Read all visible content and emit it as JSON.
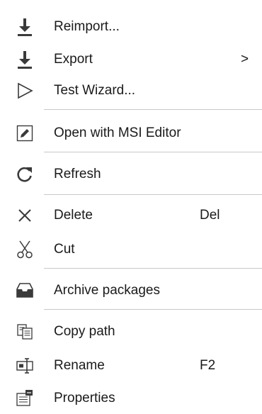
{
  "menu": {
    "items": [
      {
        "label": "Reimport...",
        "icon": "download-icon"
      },
      {
        "label": "Export",
        "icon": "download-icon",
        "submenu_indicator": ">"
      },
      {
        "label": "Test Wizard...",
        "icon": "play-outline-icon"
      },
      {
        "label": "Open with MSI Editor",
        "icon": "pencil-icon"
      },
      {
        "label": "Refresh",
        "icon": "refresh-icon"
      },
      {
        "label": "Delete",
        "icon": "close-icon",
        "shortcut": "Del"
      },
      {
        "label": "Cut",
        "icon": "scissors-icon"
      },
      {
        "label": "Archive packages",
        "icon": "archive-icon"
      },
      {
        "label": "Copy path",
        "icon": "copy-icon"
      },
      {
        "label": "Rename",
        "icon": "rename-icon",
        "shortcut": "F2"
      },
      {
        "label": "Properties",
        "icon": "properties-icon"
      }
    ]
  },
  "colors": {
    "background": "#ffffff",
    "text": "#1a1a1a",
    "icon": "#3a3a3a",
    "separator": "#c8c8c8"
  }
}
